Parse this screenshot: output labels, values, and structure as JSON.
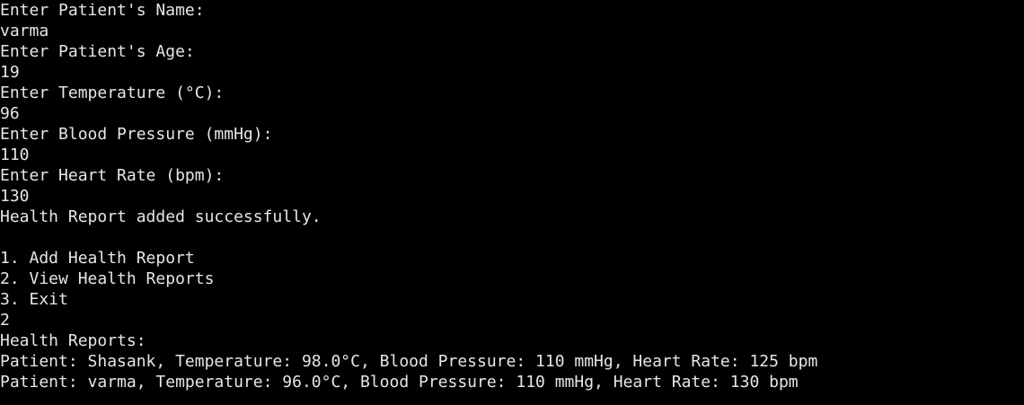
{
  "colors": {
    "background": "#000000",
    "text": "#e6e6e6"
  },
  "terminal": {
    "lines": [
      "Enter Patient's Name:",
      "varma",
      "Enter Patient's Age:",
      "19",
      "Enter Temperature (°C):",
      "96",
      "Enter Blood Pressure (mmHg):",
      "110",
      "Enter Heart Rate (bpm):",
      "130",
      "Health Report added successfully.",
      "",
      "1. Add Health Report",
      "2. View Health Reports",
      "3. Exit",
      "2",
      "Health Reports:",
      "Patient: Shasank, Temperature: 98.0°C, Blood Pressure: 110 mmHg, Heart Rate: 125 bpm",
      "Patient: varma, Temperature: 96.0°C, Blood Pressure: 110 mmHg, Heart Rate: 130 bpm"
    ]
  }
}
